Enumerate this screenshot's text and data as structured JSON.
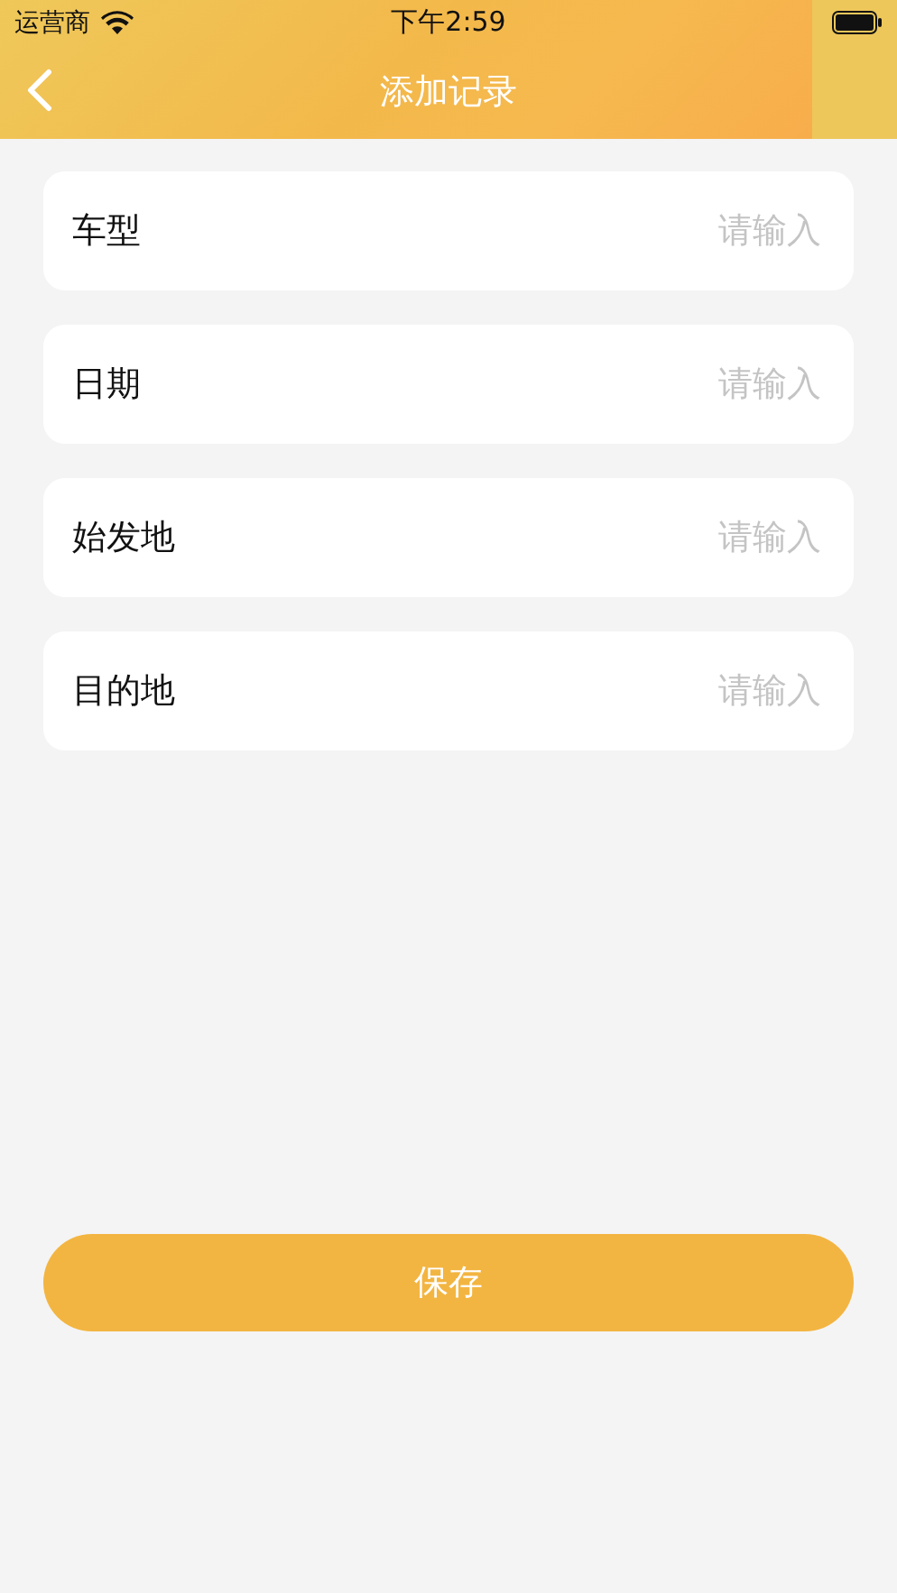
{
  "status_bar": {
    "carrier": "运营商",
    "time": "下午2:59"
  },
  "nav": {
    "title": "添加记录"
  },
  "fields": [
    {
      "label": "车型",
      "placeholder": "请输入"
    },
    {
      "label": "日期",
      "placeholder": "请输入"
    },
    {
      "label": "始发地",
      "placeholder": "请输入"
    },
    {
      "label": "目的地",
      "placeholder": "请输入"
    }
  ],
  "save_button": "保存"
}
